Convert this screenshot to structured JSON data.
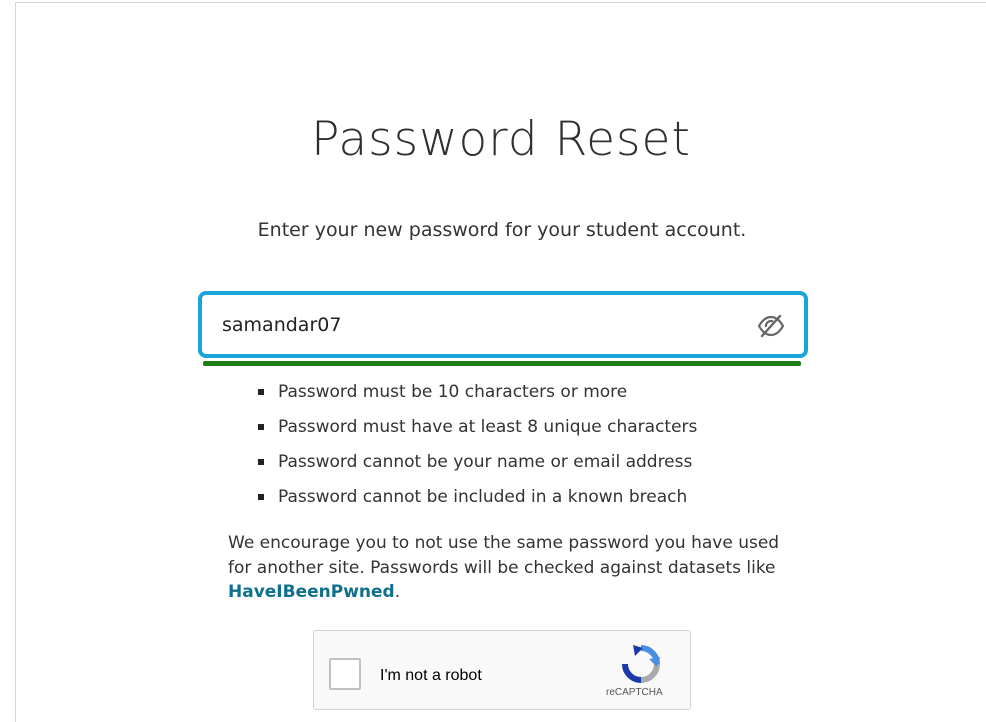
{
  "page": {
    "title": "Password Reset",
    "subtitle": "Enter your new password for your student account."
  },
  "password_field": {
    "value": "samandar07",
    "toggle_icon": "eye-slash-icon",
    "strength_color": "#1e7d12",
    "focus_color": "#1aa5d8"
  },
  "rules": [
    "Password must be 10 characters or more",
    "Password must have at least 8 unique characters",
    "Password cannot be your name or email address",
    "Password cannot be included in a known breach"
  ],
  "encourage": {
    "text": "We encourage you to not use the same password you have used for another site. Passwords will be checked against datasets like ",
    "link": "HaveIBeenPwned",
    "suffix": "."
  },
  "captcha": {
    "label": "I'm not a robot",
    "brand": "reCAPTCHA"
  }
}
